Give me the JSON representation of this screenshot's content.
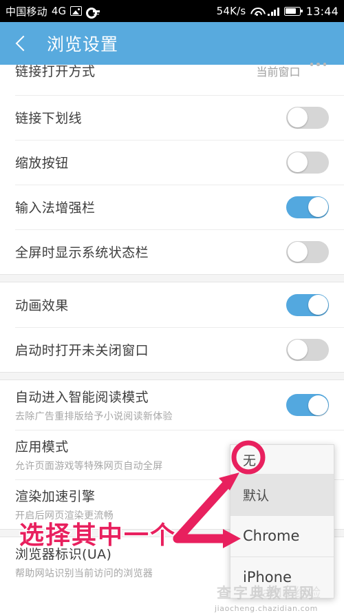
{
  "status_bar": {
    "carrier": "中国移动",
    "network": "4G",
    "icons": [
      "picture-icon",
      "key-icon",
      "wifi-icon",
      "signal-icon",
      "battery-icon"
    ],
    "speed": "54K/s",
    "time": "13:44"
  },
  "header": {
    "title": "浏览设置",
    "back_icon": "back-chevron-icon",
    "background": "#58aade"
  },
  "settings": {
    "groups": [
      {
        "rows": [
          {
            "title": "链接打开方式",
            "value": "当前窗口",
            "type": "value",
            "clipped": true
          },
          {
            "title": "链接下划线",
            "type": "toggle",
            "on": false
          },
          {
            "title": "缩放按钮",
            "type": "toggle",
            "on": false
          },
          {
            "title": "输入法增强栏",
            "type": "toggle",
            "on": true
          },
          {
            "title": "全屏时显示系统状态栏",
            "type": "toggle",
            "on": false
          }
        ]
      },
      {
        "rows": [
          {
            "title": "动画效果",
            "type": "toggle",
            "on": true
          },
          {
            "title": "启动时打开未关闭窗口",
            "type": "toggle",
            "on": false
          }
        ]
      },
      {
        "rows": [
          {
            "title": "自动进入智能阅读模式",
            "subtitle": "去除广告重排版给予小说阅读新体验",
            "type": "toggle",
            "on": true
          },
          {
            "title": "应用模式",
            "subtitle": "允许页面游戏等特殊网页自动全屏",
            "type": "toggle",
            "on": false
          },
          {
            "title": "渲染加速引擎",
            "subtitle": "开启后网页渲染更流畅",
            "type": "value",
            "value": ""
          }
        ]
      },
      {
        "rows": [
          {
            "title": "浏览器标识(UA)",
            "subtitle": "帮助网站识别当前访问的浏览器",
            "type": "value",
            "value": ""
          }
        ]
      }
    ]
  },
  "dropdown": {
    "items": [
      {
        "label": "无",
        "selected": false,
        "circled": true
      },
      {
        "label": "默认",
        "selected": true,
        "circled": false
      },
      {
        "label": "Chrome",
        "selected": false,
        "circled": false
      },
      {
        "label": "iPhone",
        "selected": false,
        "circled": false
      }
    ]
  },
  "annotation": {
    "text": "选择其中一个",
    "color": "#e8205e",
    "arrows": [
      "arrow-to-none-option",
      "arrow-to-chrome-option"
    ],
    "circle_target": "无"
  },
  "watermark": {
    "site_cn": "查字典教程网",
    "url": "jiaocheng.chazidian.com",
    "brand": "Baidu 经验"
  }
}
